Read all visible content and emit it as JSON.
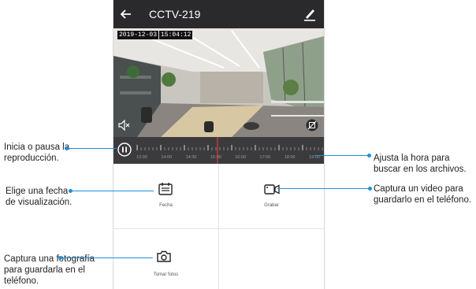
{
  "app": {
    "title": "CCTV-219",
    "back_icon": "arrow-left-icon",
    "edit_icon": "pencil-icon"
  },
  "video": {
    "date": "2019-12-03",
    "time": "15:04:12",
    "mute_icon": "speaker-muted-icon",
    "privacy_icon": "eye-off-icon"
  },
  "timeline": {
    "play_state": "paused",
    "tick_labels": [
      "13:00",
      "14:00",
      "14:30",
      "15:00",
      "16:00",
      "17:00",
      "18:00",
      "19:00"
    ]
  },
  "actions": [
    {
      "label": "Fecha",
      "icon": "calendar-icon"
    },
    {
      "label": "Grabar",
      "icon": "video-camera-icon"
    },
    {
      "label": "Tomar fotos",
      "icon": "camera-icon"
    }
  ],
  "callouts": {
    "playback": "Inicia o pausa la reproducción.",
    "date": "Elige una fecha de visualización.",
    "photo": "Captura una fotografía para guardarla en el teléfono.",
    "time": "Ajusta la hora para buscar en los archivos.",
    "record": "Captura un video para guardarlo en el teléfono."
  },
  "colors": {
    "accent": "#1e90e0",
    "topbar": "#2a2a2c",
    "timeline": "#3b3b3d",
    "cursor": "#e8353a"
  }
}
